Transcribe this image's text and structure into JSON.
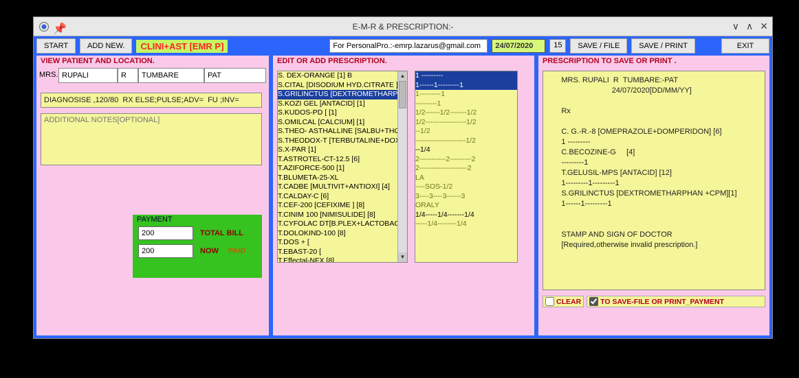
{
  "window": {
    "title": "E-M-R & PRESCRIPTION:-"
  },
  "toolbar": {
    "start": "START",
    "add_new": "ADD NEW.",
    "brand": "CLINI+AST [EMR P]",
    "email": "For PersonalPro.:-emrp.lazarus@gmail.com",
    "date": "24/07/2020",
    "day": "15",
    "save_file": "SAVE / FILE",
    "save_print": "SAVE / PRINT",
    "exit": "EXIT"
  },
  "left": {
    "heading": "VIEW PATIENT AND LOCATION.",
    "title": "MRS.",
    "first": "RUPALI",
    "mid": "R",
    "last": "TUMBARE",
    "loc": "PAT",
    "diagnosis": "DIAGNOSISE ,120/80  RX ELSE;PULSE;ADV=  FU ;INV=",
    "notes_ph": "ADDITIONAL NOTES[OPTIONAL]",
    "payment": {
      "legend": "PAYMENT",
      "total": "200",
      "total_label": "TOTAL BILL",
      "paid": "200",
      "now_label": "NOW",
      "paid_label": "PAID"
    }
  },
  "mid": {
    "heading": "EDIT OR ADD PRESCRIPTION.",
    "drugs": [
      "S. DEX-ORANGE        [1] B",
      "S.CITAL [DISODIUM HYD.CITRATE ]",
      "S.GRILINCTUS [DEXTROMETHARPH",
      "S.KOZI GEL [ANTACID]    [1]",
      "S.KUDOS-PD [   [1]",
      "S.OMILCAL [CALCIUM]    [1]",
      "S.THEO-  ASTHALLINE [SALBU+THO",
      "S.THEODOX-T  [TERBUTALINE+DOX",
      "S.X-PAR    [1]",
      "T.ASTROTEL-CT-12.5        [6]",
      "T.AZIFORCE-500    [1]",
      "T.BLUMETA-25-XL",
      "T.CADBE [MULTIVIT+ANTIOXI]    [4]",
      "T.CALDAY-C    [6]",
      "T.CEF-200 [CEFIXIME ] [8]",
      "T.CINIM 100 [NIMISULIDE] [8]",
      "T.CYFOLAC DT[B.PLEX+LACTOBACI",
      "T.DOLOKIND-100    [8]",
      "T.DOS +        [",
      "T.EBAST-20    [",
      "T.Effectal-NFX    [8]"
    ],
    "drugs_selected_index": 2,
    "dosage": [
      {
        "t": "1 ---------",
        "sel": true
      },
      {
        "t": "1------1---------1",
        "sel": true
      },
      {
        "t": "1---------1",
        "cls": "olive"
      },
      {
        "t": "---------1",
        "cls": "olive"
      },
      {
        "t": "1/2------1/2-------1/2",
        "cls": "olive"
      },
      {
        "t": "1/2-----------------1/2",
        "cls": "olive"
      },
      {
        "t": "--1/2",
        "cls": "olive"
      },
      {
        "t": "---------------------1/2",
        "cls": "olive"
      },
      {
        "t": "--1/4",
        "cls": ""
      },
      {
        "t": "2-----------2---------2",
        "cls": "olive"
      },
      {
        "t": "2--------------------2",
        "cls": "olive"
      },
      {
        "t": "LA",
        "cls": "olive"
      },
      {
        "t": "----SOS-1/2",
        "cls": "olive"
      },
      {
        "t": "3----3----3------3",
        "cls": "olive"
      },
      {
        "t": "ORALY",
        "cls": "olive"
      },
      {
        "t": "1/4-----1/4-------1/4",
        "cls": ""
      },
      {
        "t": "-----1/4--------1/4",
        "cls": "olive"
      }
    ]
  },
  "right": {
    "heading": "PRESCRIPTION TO SAVE OR PRINT .",
    "text": "      MRS. RUPALI  R  TUMBARE:-PAT\n                              24/07/2020[DD/MM/YY]\n\n      Rx\n\n      C. G.-R.-8 [OMEPRAZOLE+DOMPERIDON] [6]\n      1 ---------\n      C.BECOZINE-G     [4]\n      ---------1\n      T.GELUSIL-MPS [ANTACID] [12]\n      1---------1---------1\n      S.GRILINCTUS [DEXTROMETHARPHAN +CPM][1]\n      1------1---------1\n\n\n      STAMP AND SIGN OF DOCTOR\n      [Required,otherwise invalid prescription.]",
    "clear": "CLEAR",
    "save_check": "TO SAVE-FILE OR PRINT_PAYMENT"
  }
}
